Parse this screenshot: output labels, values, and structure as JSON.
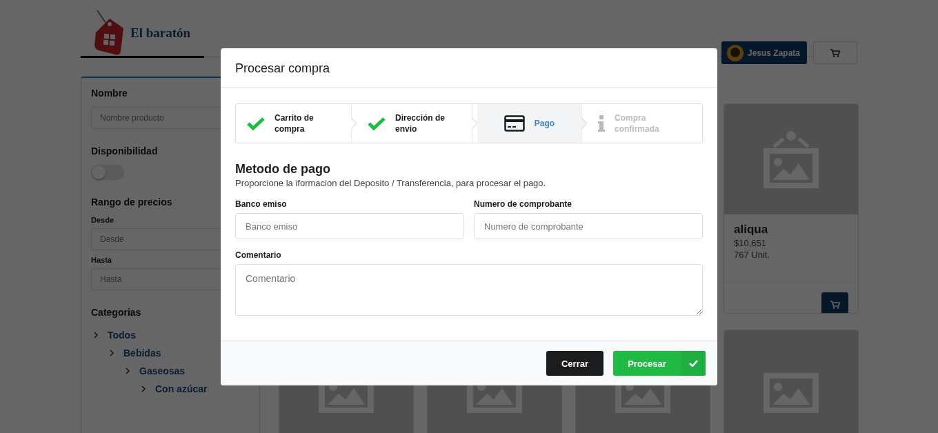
{
  "header": {
    "brand": "El baratón",
    "user": {
      "name": "Jesus Zapata"
    }
  },
  "filters": {
    "name": {
      "label": "Nombre",
      "placeholder": "Nombre producto"
    },
    "availability": {
      "label": "Disponibilidad",
      "on": false
    },
    "price_range": {
      "title": "Rango de precios",
      "from": {
        "label": "Desde",
        "placeholder": "Desde"
      },
      "to": {
        "label": "Hasta",
        "placeholder": "Hasta"
      }
    },
    "categories": {
      "title": "Categorias",
      "tree": [
        {
          "label": "Todos",
          "children": [
            {
              "label": "Bebidas",
              "children": [
                {
                  "label": "Gaseosas",
                  "children": [
                    {
                      "label": "Con azúcar"
                    }
                  ]
                }
              ]
            }
          ]
        }
      ]
    }
  },
  "products": [
    {
      "kind": "card",
      "name": "aliqua",
      "price": "$10,651",
      "stock": "767 Unit."
    },
    {
      "kind": "picture"
    },
    {
      "kind": "picture"
    },
    {
      "kind": "picture"
    },
    {
      "kind": "picture"
    }
  ],
  "modal": {
    "title": "Procesar compra",
    "steps": [
      {
        "label": "Carrito de compra",
        "completed": true,
        "selected": false
      },
      {
        "label": "Dirección de envio",
        "completed": true,
        "selected": false
      },
      {
        "label": "Pago",
        "completed": false,
        "selected": true
      },
      {
        "label": "Compra confirmada",
        "completed": false,
        "selected": false
      }
    ],
    "heading": "Metodo de pago",
    "description": "Proporcione la iformacion del Deposito / Transferencia, para procesar el pago.",
    "fields": [
      {
        "label": "Banco emiso",
        "placeholder": "Banco emiso"
      },
      {
        "label": "Numero de comprobante",
        "placeholder": "Numero de comprobante"
      }
    ],
    "comment": {
      "label": "Comentario",
      "placeholder": "Comentario"
    },
    "buttons": [
      {
        "label": "Cerrar",
        "kind": "close"
      },
      {
        "label": "Procesar",
        "kind": "primary"
      }
    ]
  }
}
